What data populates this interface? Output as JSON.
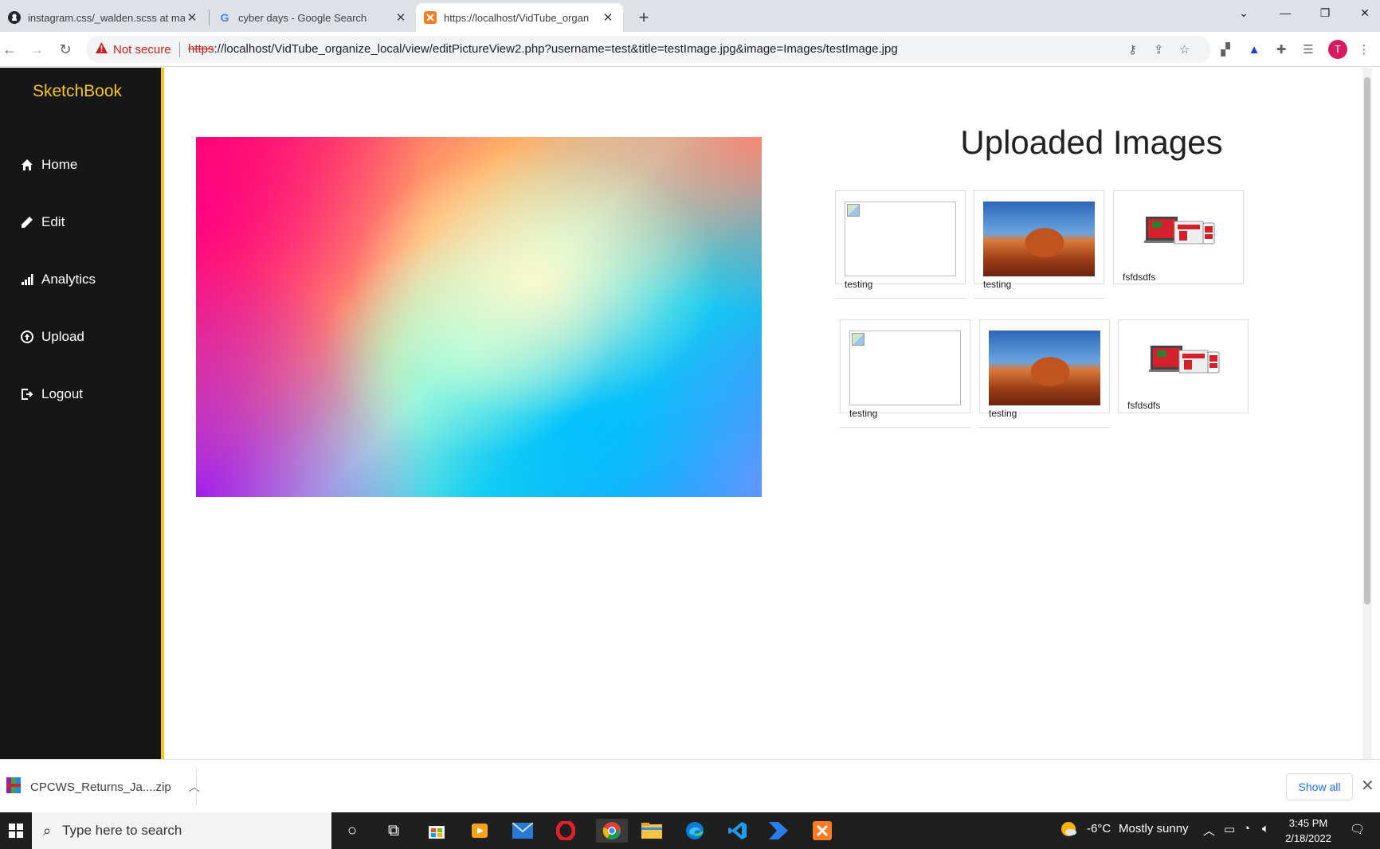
{
  "browser": {
    "tabs": [
      {
        "title": "instagram.css/_walden.scss at ma",
        "icon": "github-icon",
        "active": false
      },
      {
        "title": "cyber days - Google Search",
        "icon": "google-icon",
        "active": false
      },
      {
        "title": "https://localhost/VidTube_organ",
        "icon": "xampp-icon",
        "active": true
      }
    ],
    "new_tab": "+",
    "security_label": "Not secure",
    "url_scheme": "https",
    "url_rest": "://localhost/VidTube_organize_local/view/editPictureView2.php?username=test&title=testImage.jpg&image=Images/testImage.jpg",
    "profile_initial": "T"
  },
  "sidebar": {
    "brand": "SketchBook",
    "items": [
      {
        "label": "Home",
        "icon": "home-icon"
      },
      {
        "label": "Edit",
        "icon": "pencil-icon"
      },
      {
        "label": "Analytics",
        "icon": "bar-chart-icon"
      },
      {
        "label": "Upload",
        "icon": "upload-icon"
      },
      {
        "label": "Logout",
        "icon": "logout-icon"
      }
    ]
  },
  "main": {
    "gallery_title": "Uploaded Images",
    "cards": [
      {
        "label": "testing",
        "image": "broken"
      },
      {
        "label": "testing",
        "image": "desert"
      },
      {
        "label": "fsfdsdfs",
        "image": "mockup"
      },
      {
        "label": "testing",
        "image": "broken"
      },
      {
        "label": "testing",
        "image": "desert"
      },
      {
        "label": "fsfdsdfs",
        "image": "mockup"
      }
    ]
  },
  "downloads": {
    "file_name": "CPCWS_Returns_Ja....zip",
    "show_all": "Show all"
  },
  "taskbar": {
    "search_placeholder": "Type here to search",
    "weather_temp": "-6°C",
    "weather_text": "Mostly sunny",
    "time": "3:45 PM",
    "date": "2/18/2022"
  },
  "colors": {
    "sidebar_bg": "#161616",
    "accent": "#f5c518",
    "danger": "#c5221f",
    "link": "#1a73e8"
  }
}
